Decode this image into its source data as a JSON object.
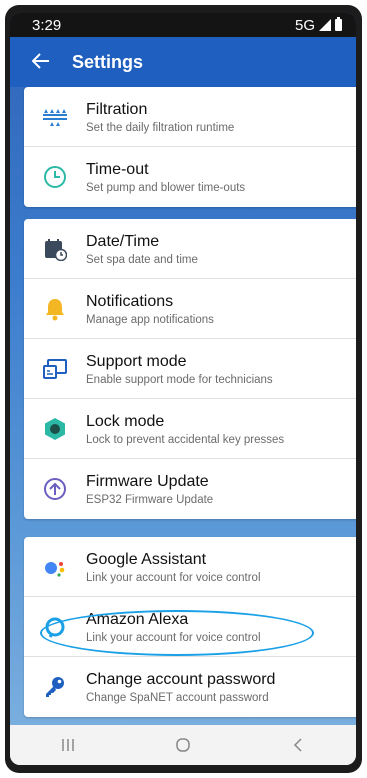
{
  "status_bar": {
    "time": "3:29",
    "network": "5G"
  },
  "app_bar": {
    "title": "Settings",
    "back_icon": "arrow-left-icon"
  },
  "groups": [
    {
      "items": [
        {
          "title": "Filtration",
          "subtitle": "Set the daily filtration runtime",
          "icon": "filtration-icon"
        },
        {
          "title": "Time-out",
          "subtitle": "Set pump and blower time-outs",
          "icon": "clock-icon"
        }
      ]
    },
    {
      "items": [
        {
          "title": "Date/Time",
          "subtitle": "Set spa date and time",
          "icon": "calendar-clock-icon"
        },
        {
          "title": "Notifications",
          "subtitle": "Manage app notifications",
          "icon": "bell-icon"
        },
        {
          "title": "Support mode",
          "subtitle": "Enable support mode for technicians",
          "icon": "cast-icon"
        },
        {
          "title": "Lock mode",
          "subtitle": "Lock to prevent accidental key presses",
          "icon": "lock-hexagon-icon"
        },
        {
          "title": "Firmware Update",
          "subtitle": "ESP32 Firmware Update",
          "icon": "upload-circle-icon"
        }
      ]
    },
    {
      "items": [
        {
          "title": "Google Assistant",
          "subtitle": "Link your account for voice control",
          "icon": "google-assistant-icon"
        },
        {
          "title": "Amazon Alexa",
          "subtitle": "Link your account for voice control",
          "icon": "alexa-icon"
        },
        {
          "title": "Change account password",
          "subtitle": "Change SpaNET account password",
          "icon": "key-icon"
        }
      ]
    }
  ],
  "colors": {
    "app_bar": "#1f5fbf",
    "icon_teal": "#2bb9a6",
    "icon_bell": "#f2b722",
    "icon_blue": "#1f5fbf",
    "highlight": "#1aa0e6"
  },
  "nav": {
    "recent_icon": "recent-apps-icon",
    "home_icon": "home-icon",
    "back_icon": "back-icon"
  }
}
